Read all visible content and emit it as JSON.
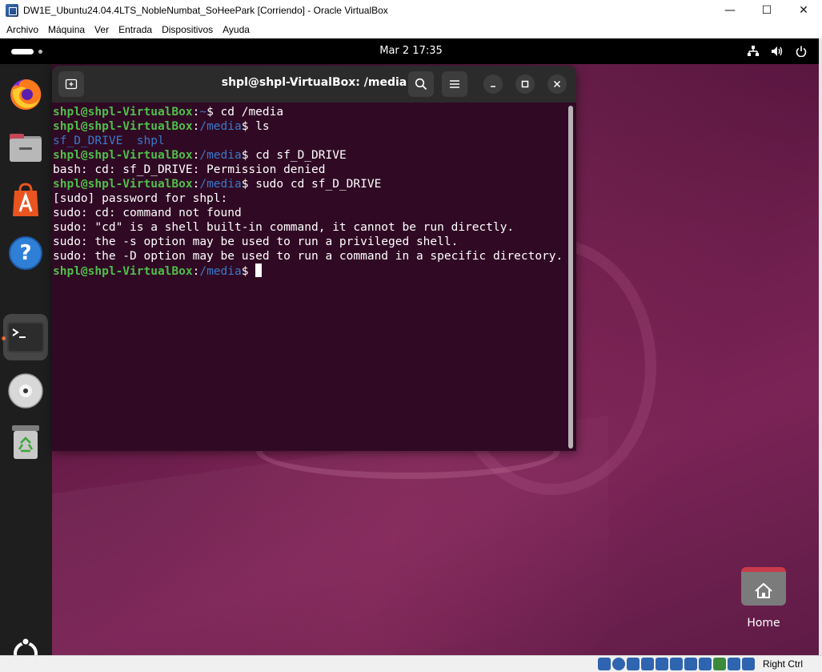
{
  "host": {
    "title": "DW1E_Ubuntu24.04.4LTS_NobleNumbat_SoHeePark [Corriendo] - Oracle VirtualBox",
    "controls": {
      "minimize": "—",
      "maximize": "☐",
      "close": "✕"
    },
    "menu": [
      "Archivo",
      "Máquina",
      "Ver",
      "Entrada",
      "Dispositivos",
      "Ayuda"
    ],
    "statusbar": {
      "host_key": "Right Ctrl"
    }
  },
  "topbar": {
    "clock": "Mar 2  17:35",
    "tray_icons": [
      "network-icon",
      "volume-icon",
      "power-icon"
    ]
  },
  "dock": {
    "apps": [
      {
        "name": "firefox",
        "icon": "firefox-icon"
      },
      {
        "name": "files",
        "icon": "files-icon"
      },
      {
        "name": "app-center",
        "icon": "app-center-icon"
      },
      {
        "name": "help",
        "icon": "help-icon"
      },
      {
        "name": "terminal",
        "icon": "terminal-icon",
        "active": true
      },
      {
        "name": "dvd",
        "icon": "disc-icon"
      },
      {
        "name": "trash",
        "icon": "trash-icon"
      }
    ],
    "show_apps": "ubuntu-logo-icon"
  },
  "terminal": {
    "title": "shpl@shpl-VirtualBox: /media",
    "new_tab_symbol": "+",
    "lines": [
      {
        "type": "prompt",
        "user": "shpl@shpl-VirtualBox",
        "sep": ":",
        "path": "~",
        "cmd": "$ cd /media"
      },
      {
        "type": "prompt",
        "user": "shpl@shpl-VirtualBox",
        "sep": ":",
        "path": "/media",
        "cmd": "$ ls"
      },
      {
        "type": "dirs",
        "text": "sf_D_DRIVE  shpl"
      },
      {
        "type": "prompt",
        "user": "shpl@shpl-VirtualBox",
        "sep": ":",
        "path": "/media",
        "cmd": "$ cd sf_D_DRIVE"
      },
      {
        "type": "out",
        "text": "bash: cd: sf_D_DRIVE: Permission denied"
      },
      {
        "type": "prompt",
        "user": "shpl@shpl-VirtualBox",
        "sep": ":",
        "path": "/media",
        "cmd": "$ sudo cd sf_D_DRIVE"
      },
      {
        "type": "out",
        "text": "[sudo] password for shpl:"
      },
      {
        "type": "out",
        "text": "sudo: cd: command not found"
      },
      {
        "type": "out",
        "text": "sudo: \"cd\" is a shell built-in command, it cannot be run directly."
      },
      {
        "type": "out",
        "text": "sudo: the -s option may be used to run a privileged shell."
      },
      {
        "type": "out",
        "text": "sudo: the -D option may be used to run a command in a specific directory."
      },
      {
        "type": "prompt",
        "user": "shpl@shpl-VirtualBox",
        "sep": ":",
        "path": "/media",
        "cmd": "$ ",
        "cursor": true
      }
    ]
  },
  "desktop": {
    "home_label": "Home"
  },
  "colors": {
    "terminal_bg": "#300a24",
    "prompt_user": "#4fbf4a",
    "prompt_path": "#3a78c9",
    "accent": "#e95420"
  }
}
